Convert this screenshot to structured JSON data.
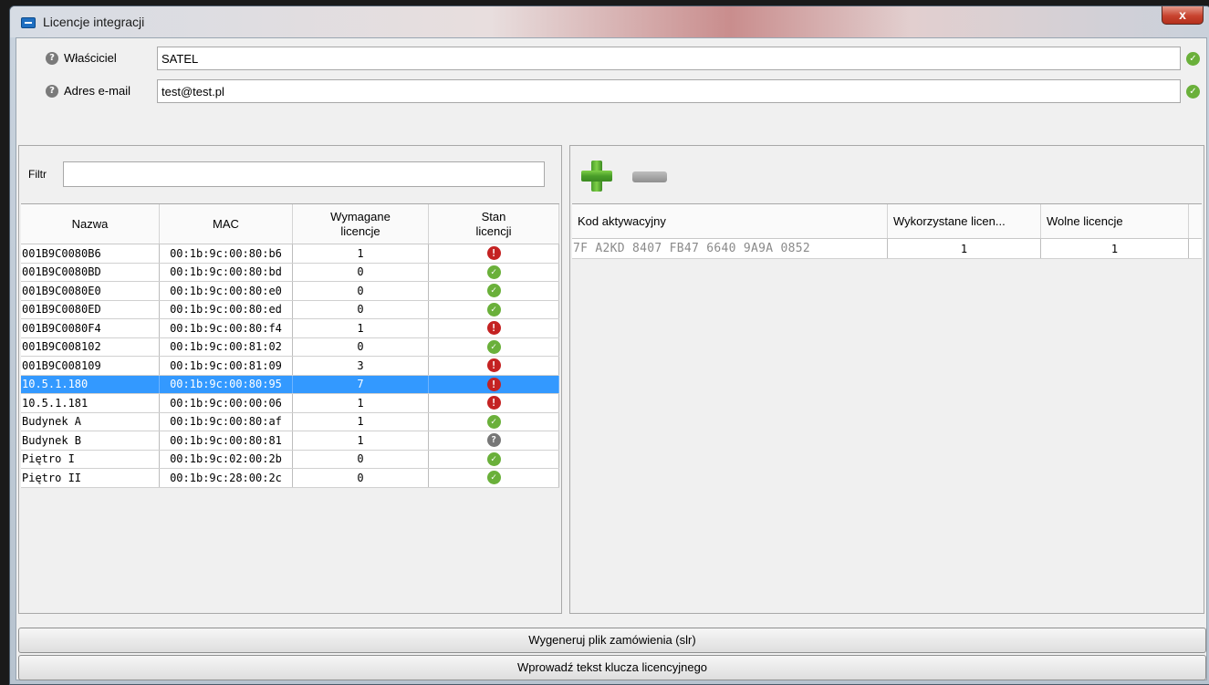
{
  "window": {
    "title": "Licencje integracji",
    "close_label": "x"
  },
  "owner": {
    "label": "Właściciel",
    "value": "SATEL"
  },
  "email": {
    "label": "Adres e-mail",
    "value": "test@test.pl"
  },
  "filter": {
    "label": "Filtr",
    "value": ""
  },
  "devices": {
    "columns": [
      "Nazwa",
      "MAC",
      "Wymagane licencje",
      "Stan licencji"
    ],
    "rows": [
      {
        "name": "001B9C0080B6",
        "mac": "00:1b:9c:00:80:b6",
        "required": "1",
        "status": "error"
      },
      {
        "name": "001B9C0080BD",
        "mac": "00:1b:9c:00:80:bd",
        "required": "0",
        "status": "ok"
      },
      {
        "name": "001B9C0080E0",
        "mac": "00:1b:9c:00:80:e0",
        "required": "0",
        "status": "ok"
      },
      {
        "name": "001B9C0080ED",
        "mac": "00:1b:9c:00:80:ed",
        "required": "0",
        "status": "ok"
      },
      {
        "name": "001B9C0080F4",
        "mac": "00:1b:9c:00:80:f4",
        "required": "1",
        "status": "error"
      },
      {
        "name": "001B9C008102",
        "mac": "00:1b:9c:00:81:02",
        "required": "0",
        "status": "ok"
      },
      {
        "name": "001B9C008109",
        "mac": "00:1b:9c:00:81:09",
        "required": "3",
        "status": "error"
      },
      {
        "name": "10.5.1.180",
        "mac": "00:1b:9c:00:80:95",
        "required": "7",
        "status": "error",
        "selected": true
      },
      {
        "name": "10.5.1.181",
        "mac": "00:1b:9c:00:00:06",
        "required": "1",
        "status": "error"
      },
      {
        "name": "Budynek A",
        "mac": "00:1b:9c:00:80:af",
        "required": "1",
        "status": "ok"
      },
      {
        "name": "Budynek B",
        "mac": "00:1b:9c:00:80:81",
        "required": "1",
        "status": "unknown"
      },
      {
        "name": "Piętro I",
        "mac": "00:1b:9c:02:00:2b",
        "required": "0",
        "status": "ok"
      },
      {
        "name": "Piętro II",
        "mac": "00:1b:9c:28:00:2c",
        "required": "0",
        "status": "ok"
      }
    ]
  },
  "licenses": {
    "columns": [
      "Kod aktywacyjny",
      "Wykorzystane licen...",
      "Wolne licencje"
    ],
    "rows": [
      {
        "code": "7F A2KD 8407 FB47 6640 9A9A 0852",
        "used": "1",
        "free": "1"
      }
    ]
  },
  "buttons": {
    "generate": "Wygeneruj plik zamówienia (slr)",
    "enter_key": "Wprowadź tekst klucza licencyjnego"
  },
  "colors": {
    "ok": "#6ab03a",
    "error": "#c42222",
    "unknown": "#777777",
    "selection": "#3399ff"
  }
}
